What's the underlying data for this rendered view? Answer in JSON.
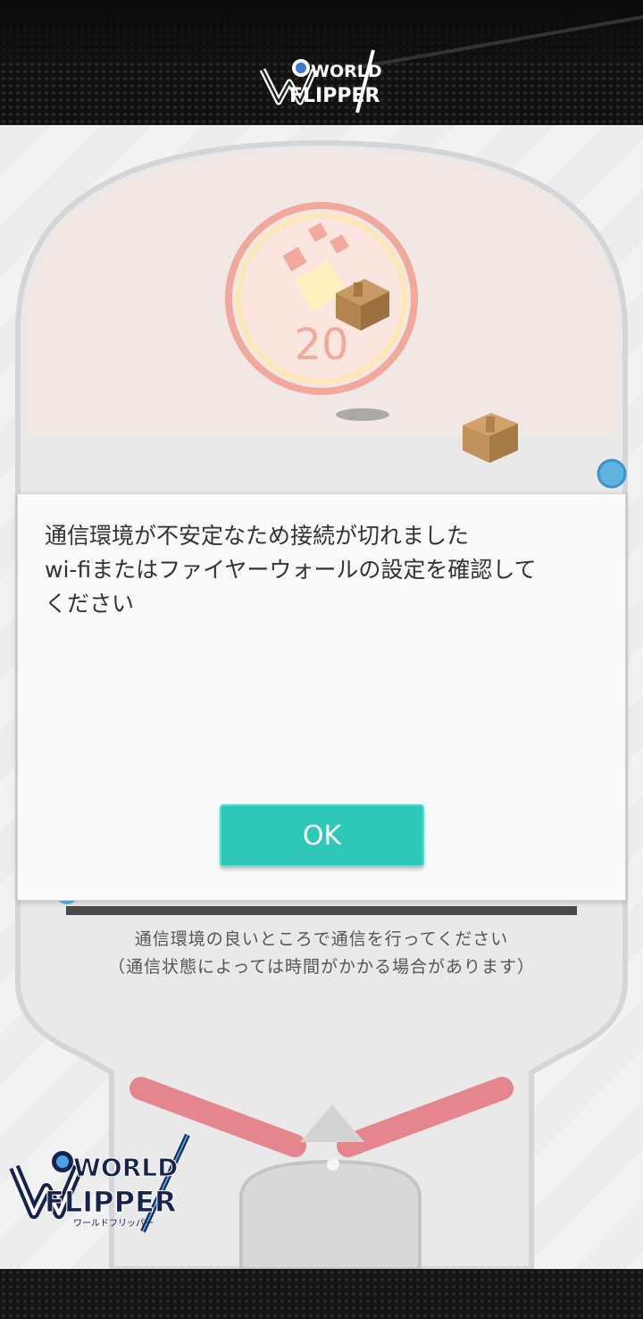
{
  "header": {
    "logo_text_line1": "WORLD",
    "logo_text_line2": "FLIPPER"
  },
  "board": {
    "counter_value": "20"
  },
  "loading": {
    "line1": "通信環境の良いところで通信を行ってください",
    "line2": "（通信状態によっては時間がかかる場合があります）"
  },
  "footer_logo": {
    "line1": "WORLD",
    "line2": "FLIPPER",
    "katakana": "ワールドフリッパー"
  },
  "dialog": {
    "message": "通信環境が不安定なため接続が切れました\nwi-fiまたはファイヤーウォールの設定を確認して\nください",
    "ok_label": "OK"
  },
  "colors": {
    "accent": "#2ec8b9",
    "flipper": "#e5868f",
    "counter": "#f0a99a"
  }
}
